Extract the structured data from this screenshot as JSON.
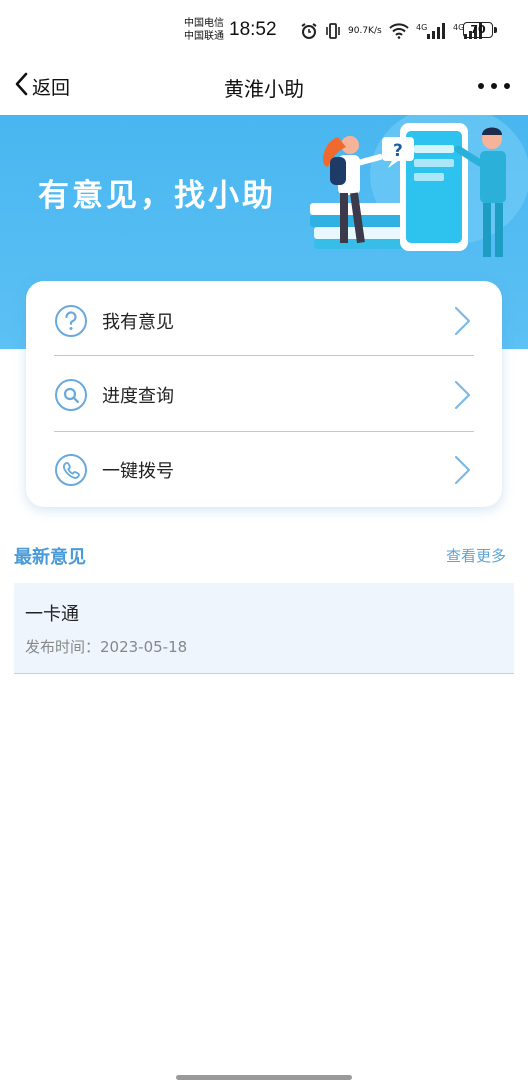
{
  "status_bar": {
    "carrier_1": "中国电信",
    "carrier_2": "中国联通",
    "time": "18:52",
    "net_speed_value": "90.7",
    "net_speed_unit": "K/s",
    "signal_1_label": "4G",
    "signal_2_label": "4G",
    "battery": "70"
  },
  "nav": {
    "back_label": "返回",
    "title": "黄淮小助"
  },
  "banner": {
    "slogan": "有意见，找小助",
    "bubble_mark": "?"
  },
  "menu": [
    {
      "label": "我有意见",
      "icon": "question-icon"
    },
    {
      "label": "进度查询",
      "icon": "search-icon"
    },
    {
      "label": "一键拨号",
      "icon": "phone-icon"
    }
  ],
  "latest": {
    "title": "最新意见",
    "more_label": "查看更多",
    "items": [
      {
        "title": "一卡通",
        "meta": "发布时间：2023-05-18"
      }
    ]
  },
  "colors": {
    "banner": "#4fb9f1",
    "accent": "#4a9bd8",
    "item_bg": "#eef5fd"
  }
}
